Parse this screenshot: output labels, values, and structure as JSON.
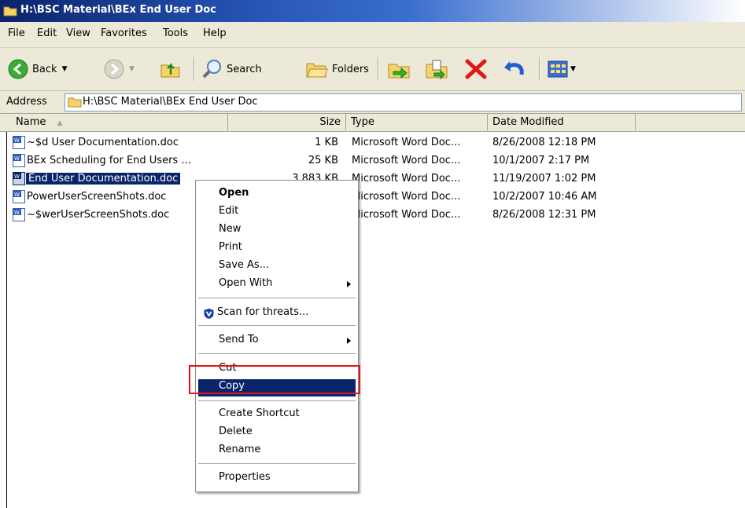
{
  "window": {
    "title": "H:\\BSC Material\\BEx End User Doc"
  },
  "menubar": [
    "File",
    "Edit",
    "View",
    "Favorites",
    "Tools",
    "Help"
  ],
  "toolbar": {
    "back": "Back",
    "search": "Search",
    "folders": "Folders"
  },
  "address": {
    "label": "Address",
    "value": "H:\\BSC Material\\BEx End User Doc"
  },
  "columns": {
    "name": "Name",
    "size": "Size",
    "type": "Type",
    "date": "Date Modified"
  },
  "files": [
    {
      "name": "~$d User Documentation.doc",
      "size": "1 KB",
      "type": "Microsoft Word Doc...",
      "date": "8/26/2008 12:18 PM"
    },
    {
      "name": "BEx Scheduling for End Users ...",
      "size": "25 KB",
      "type": "Microsoft Word Doc...",
      "date": "10/1/2007 2:17 PM"
    },
    {
      "name": "End User Documentation.doc",
      "size": "3,883 KB",
      "type": "Microsoft Word Doc...",
      "date": "11/19/2007 1:02 PM",
      "selected": true
    },
    {
      "name": "PowerUserScreenShots.doc",
      "size": "",
      "type": "Microsoft Word Doc...",
      "date": "10/2/2007 10:46 AM"
    },
    {
      "name": "~$werUserScreenShots.doc",
      "size": "",
      "type": "Microsoft Word Doc...",
      "date": "8/26/2008 12:31 PM"
    }
  ],
  "context_menu": {
    "open": "Open",
    "edit": "Edit",
    "new": "New",
    "print": "Print",
    "save_as": "Save As...",
    "open_with": "Open With",
    "scan": "Scan for threats...",
    "send_to": "Send To",
    "cut": "Cut",
    "copy": "Copy",
    "create_shortcut": "Create Shortcut",
    "delete": "Delete",
    "rename": "Rename",
    "properties": "Properties",
    "highlighted": "Copy"
  },
  "colors": {
    "selection": "#0a246a",
    "annotation": "#e8121a",
    "title_bar": "#0a246a"
  }
}
